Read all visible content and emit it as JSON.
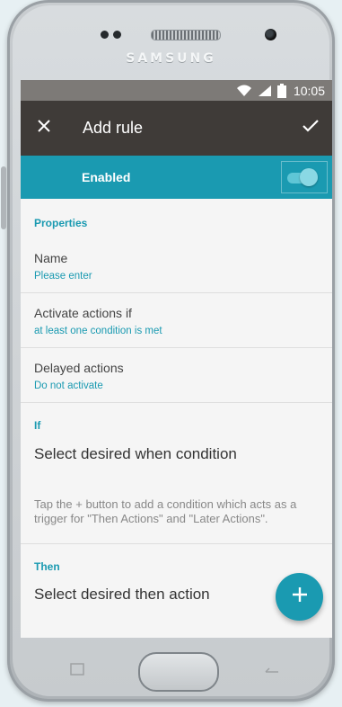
{
  "device": {
    "brand": "SAMSUNG"
  },
  "status_bar": {
    "time": "10:05",
    "icons": [
      "wifi-icon",
      "signal-icon",
      "battery-icon"
    ]
  },
  "app_bar": {
    "close_icon": "close-icon",
    "title": "Add rule",
    "confirm_icon": "check-icon"
  },
  "enabled": {
    "label": "Enabled",
    "toggle_on": true
  },
  "properties": {
    "header": "Properties",
    "items": [
      {
        "primary": "Name",
        "secondary": "Please enter"
      },
      {
        "primary": "Activate actions if",
        "secondary": "at least one condition is met"
      },
      {
        "primary": "Delayed actions",
        "secondary": "Do not activate"
      }
    ]
  },
  "if_section": {
    "header": "If",
    "title": "Select desired when condition",
    "hint": "Tap the + button to add a condition which acts as a trigger for \"Then Actions\" and \"Later Actions\"."
  },
  "then_section": {
    "header": "Then",
    "title": "Select desired then action"
  },
  "fab": {
    "icon": "plus-icon"
  },
  "colors": {
    "accent": "#1a9ab1",
    "app_bar": "#3f3b38",
    "status_bar": "#7d7a77",
    "background": "#f5f5f5"
  }
}
